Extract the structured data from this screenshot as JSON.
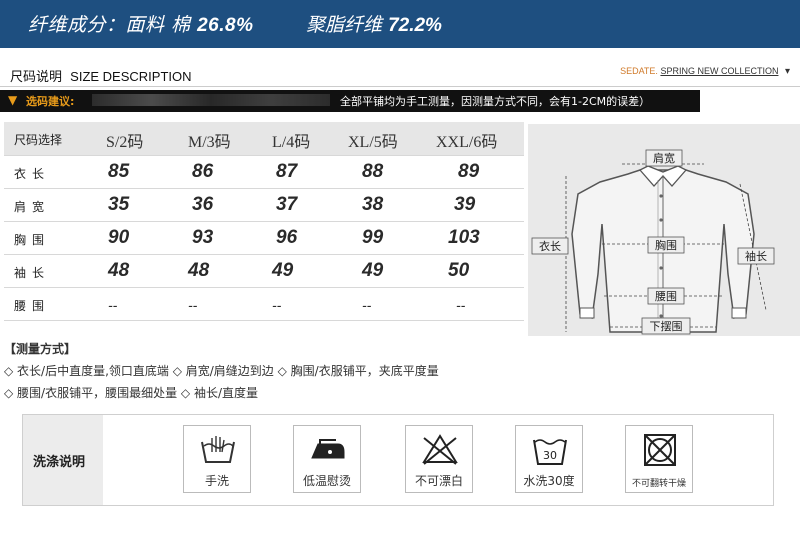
{
  "banner": {
    "fabric_label": "纤维成分：面料 棉",
    "fabric_value": "26.8%",
    "fiber_label": "聚脂纤维",
    "fiber_value": "72.2%"
  },
  "size_section": {
    "title_cn": "尺码说明",
    "title_en": "SIZE DESCRIPTION",
    "brand_prefix": "SEDATE.",
    "brand_collection": "SPRING NEW COLLECTION"
  },
  "suggestion": {
    "label": "选码建议:",
    "note": "全部平铺均为手工测量，因测量方式不同，会有1-2CM的误差）"
  },
  "table": {
    "header_label": "尺码选择",
    "sizes": [
      "S/2码",
      "M/3码",
      "L/4码",
      "XL/5码",
      "XXL/6码"
    ],
    "rows": [
      {
        "label": "衣长",
        "values": [
          "85",
          "86",
          "87",
          "88",
          "89"
        ]
      },
      {
        "label": "肩宽",
        "values": [
          "35",
          "36",
          "37",
          "38",
          "39"
        ]
      },
      {
        "label": "胸围",
        "values": [
          "90",
          "93",
          "96",
          "99",
          "103"
        ]
      },
      {
        "label": "袖长",
        "values": [
          "48",
          "48",
          "49",
          "49",
          "50"
        ]
      },
      {
        "label": "腰围",
        "values": [
          "--",
          "--",
          "--",
          "--",
          "--"
        ]
      }
    ]
  },
  "diagram": {
    "shoulder": "肩宽",
    "length": "衣长",
    "chest": "胸围",
    "sleeve": "袖长",
    "waist": "腰围",
    "hem": "下摆围"
  },
  "measuring": {
    "title": "【测量方式】",
    "lines": [
      "◇ 衣长/后中直度量,领口直底端 ◇ 肩宽/肩缝边到边 ◇ 胸围/衣服铺平，夹底平度量",
      "◇ 腰围/衣服铺平，腰围最细处量 ◇ 袖长/直度量"
    ]
  },
  "wash": {
    "title": "洗涤说明",
    "items": [
      {
        "icon": "hand-wash-icon",
        "label": "手洗"
      },
      {
        "icon": "low-temp-iron-icon",
        "label": "低温慰烫"
      },
      {
        "icon": "no-bleach-icon",
        "label": "不可漂白"
      },
      {
        "icon": "wash-30-icon",
        "label": "水洗30度"
      },
      {
        "icon": "no-tumble-dry-icon",
        "label": "不可翻转干燥"
      }
    ],
    "wash_temp": "30"
  }
}
